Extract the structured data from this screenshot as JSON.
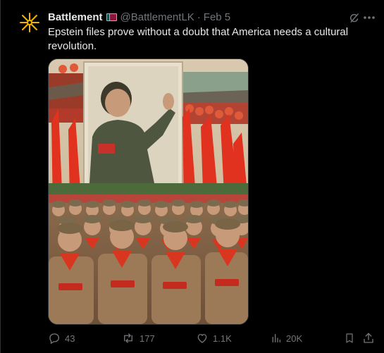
{
  "post": {
    "author_name": "Battlement",
    "author_handle": "@BattlementLK",
    "separator": "·",
    "date": "Feb 5",
    "text": "Epstein files prove without a doubt that America needs a cultural revolution."
  },
  "actions": {
    "replies": "43",
    "reposts": "177",
    "likes": "1.1K",
    "views": "20K"
  },
  "icons": {
    "avatar": "sun-emblem-icon",
    "flag": "sri-lanka-flag-icon",
    "grok": "grok-icon",
    "more": "more-icon",
    "reply": "reply-icon",
    "repost": "repost-icon",
    "like": "heart-icon",
    "views": "views-icon",
    "bookmark": "bookmark-icon",
    "share": "share-icon"
  },
  "colors": {
    "background": "#000000",
    "text": "#e7e9ea",
    "secondary": "#71767b",
    "avatar_accent": "#f0b400"
  }
}
